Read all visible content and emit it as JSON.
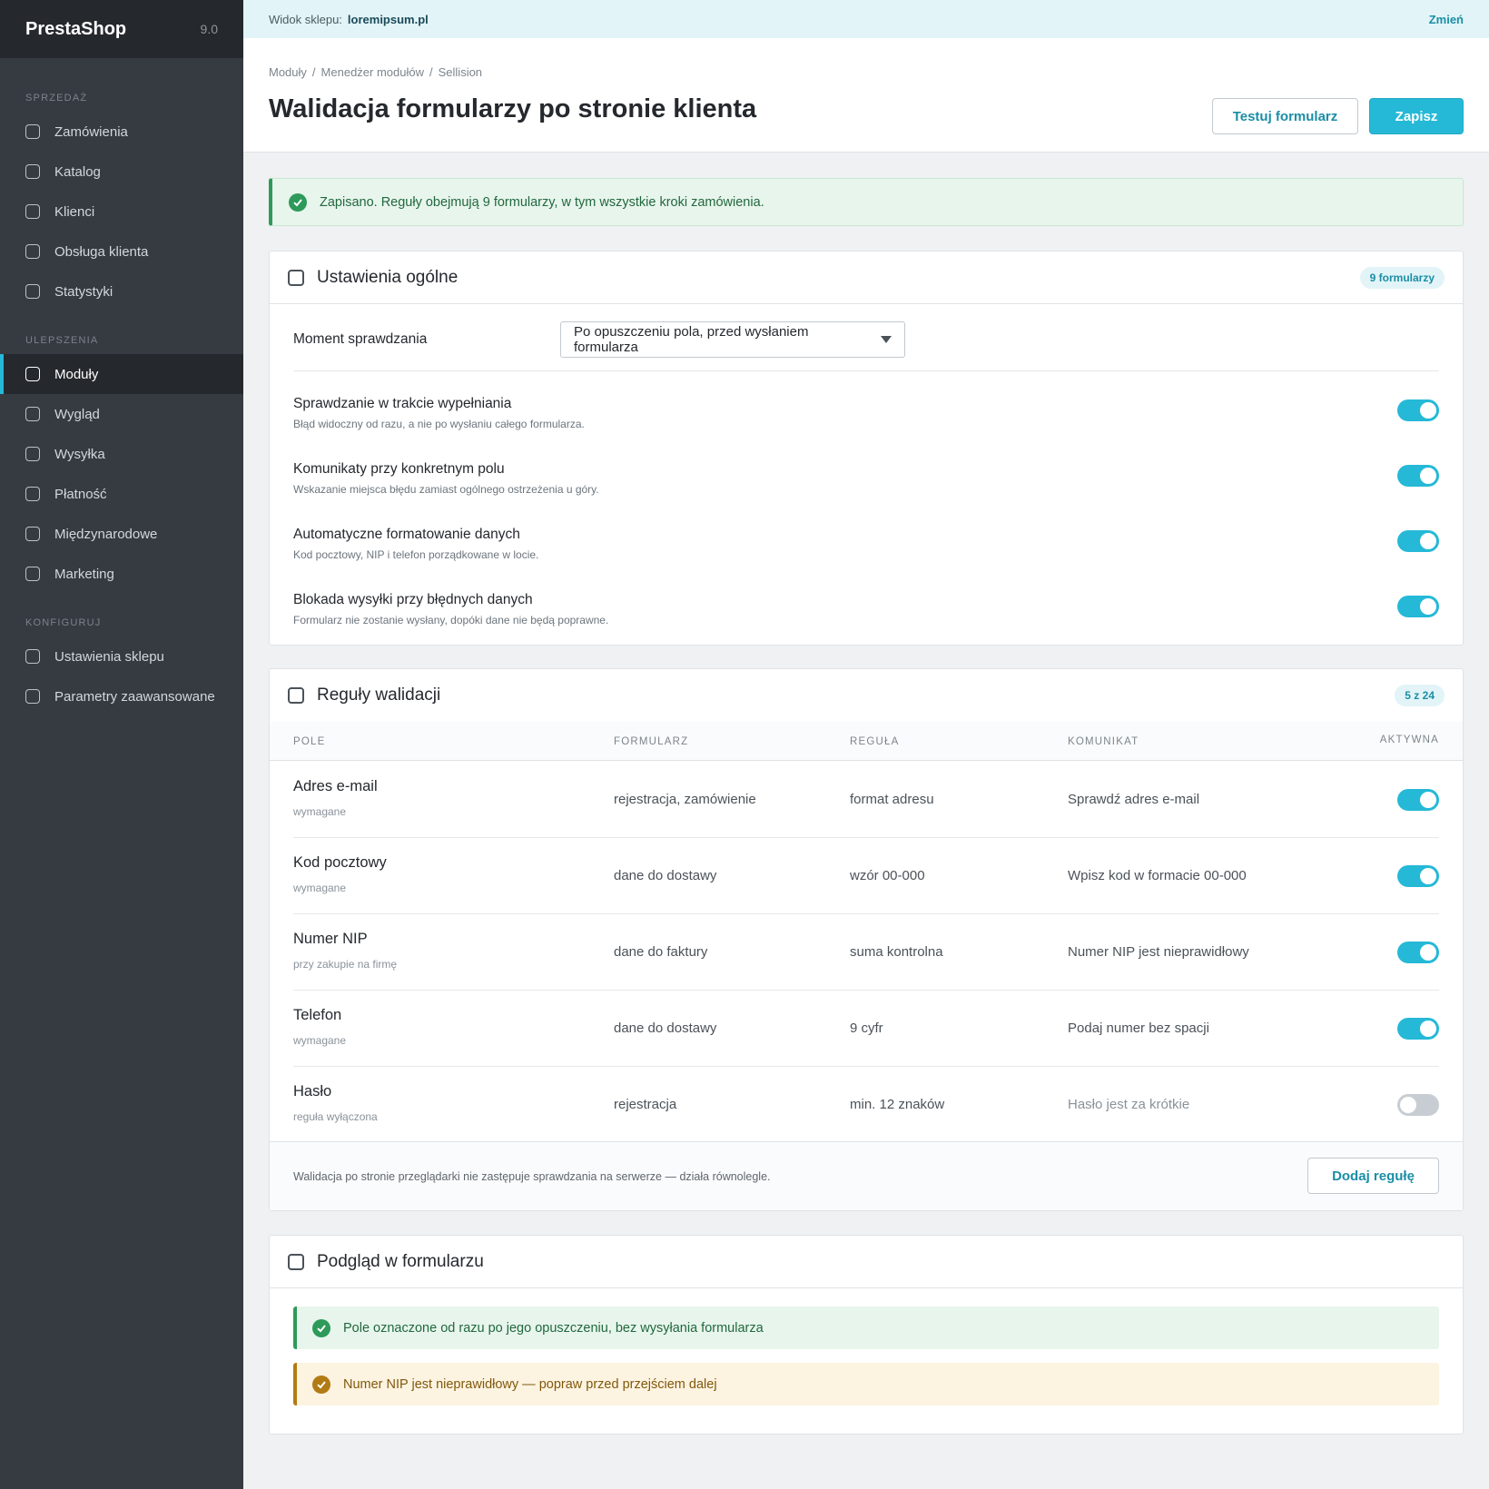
{
  "sidebar": {
    "brand": "PrestaShop",
    "version": "9.0",
    "sections": [
      {
        "label": "SPRZEDAŻ"
      },
      {
        "label": "ULEPSZENIA"
      },
      {
        "label": "KONFIGURUJ"
      }
    ],
    "items": [
      {
        "label": "Zamówienia"
      },
      {
        "label": "Katalog"
      },
      {
        "label": "Klienci"
      },
      {
        "label": "Obsługa klienta"
      },
      {
        "label": "Statystyki"
      },
      {
        "label": "Moduły"
      },
      {
        "label": "Wygląd"
      },
      {
        "label": "Wysyłka"
      },
      {
        "label": "Płatność"
      },
      {
        "label": "Międzynarodowe"
      },
      {
        "label": "Marketing"
      },
      {
        "label": "Ustawienia sklepu"
      },
      {
        "label": "Parametry zaawansowane"
      }
    ]
  },
  "topbar": {
    "shop_label": "Widok sklepu:",
    "shop_name": "loremipsum.pl",
    "change": "Zmień"
  },
  "header": {
    "breadcrumb": [
      "Moduły",
      "Menedżer modułów",
      "Sellision"
    ],
    "title": "Walidacja formularzy po stronie klienta",
    "test_button": "Testuj formularz",
    "save_button": "Zapisz"
  },
  "alert": {
    "text": "Zapisano. Reguły obejmują 9 formularzy, w tym wszystkie kroki zamówienia."
  },
  "general": {
    "title": "Ustawienia ogólne",
    "badge": "9 formularzy",
    "moment_label": "Moment sprawdzania",
    "moment_value": "Po opuszczeniu pola, przed wysłaniem formularza",
    "settings": [
      {
        "title": "Sprawdzanie w trakcie wypełniania",
        "sub": "Błąd widoczny od razu, a nie po wysłaniu całego formularza.",
        "enabled": true
      },
      {
        "title": "Komunikaty przy konkretnym polu",
        "sub": "Wskazanie miejsca błędu zamiast ogólnego ostrzeżenia u góry.",
        "enabled": true
      },
      {
        "title": "Automatyczne formatowanie danych",
        "sub": "Kod pocztowy, NIP i telefon porządkowane w locie.",
        "enabled": true
      },
      {
        "title": "Blokada wysyłki przy błędnych danych",
        "sub": "Formularz nie zostanie wysłany, dopóki dane nie będą poprawne.",
        "enabled": true
      }
    ]
  },
  "rules": {
    "title": "Reguły walidacji",
    "badge": "5 z 24",
    "columns": [
      "POLE",
      "FORMULARZ",
      "REGUŁA",
      "KOMUNIKAT",
      "AKTYWNA"
    ],
    "rows": [
      {
        "field": "Adres e-mail",
        "note": "wymagane",
        "form": "rejestracja, zamówienie",
        "rule": "format adresu",
        "message": "Sprawdź adres e-mail",
        "active": true
      },
      {
        "field": "Kod pocztowy",
        "note": "wymagane",
        "form": "dane do dostawy",
        "rule": "wzór 00-000",
        "message": "Wpisz kod w formacie 00-000",
        "active": true
      },
      {
        "field": "Numer NIP",
        "note": "przy zakupie na firmę",
        "form": "dane do faktury",
        "rule": "suma kontrolna",
        "message": "Numer NIP jest nieprawidłowy",
        "active": true
      },
      {
        "field": "Telefon",
        "note": "wymagane",
        "form": "dane do dostawy",
        "rule": "9 cyfr",
        "message": "Podaj numer bez spacji",
        "active": true
      },
      {
        "field": "Hasło",
        "note": "reguła wyłączona",
        "form": "rejestracja",
        "rule": "min. 12 znaków",
        "message": "Hasło jest za krótkie",
        "active": false
      }
    ],
    "footer_note": "Walidacja po stronie przeglądarki nie zastępuje sprawdzania na serwerze — działa równolegle.",
    "add_button": "Dodaj regułę"
  },
  "preview": {
    "title": "Podgląd w formularzu",
    "success": "Pole oznaczone od razu po jego opuszczeniu, bez wysyłania formularza",
    "warning": "Numer NIP jest nieprawidłowy — popraw przed przejściem dalej"
  },
  "colors": {
    "accent": "#25b9d7",
    "sidebar": "#363a41",
    "success": "#2e9a5a",
    "warning": "#b27b14"
  }
}
